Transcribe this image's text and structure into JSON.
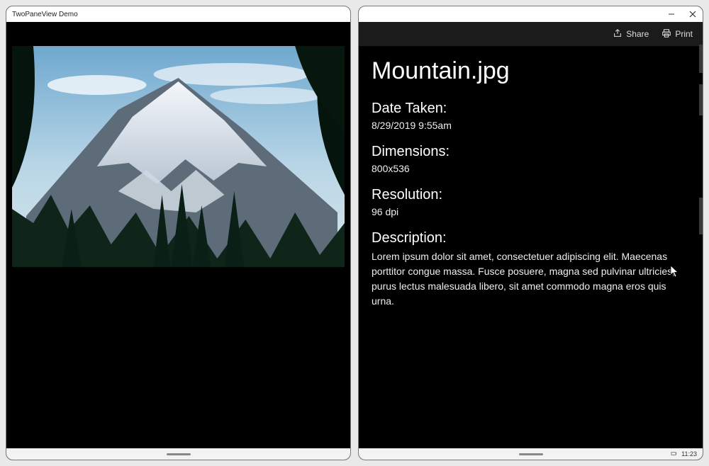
{
  "window": {
    "title": "TwoPaneView Demo",
    "clock": "11:23"
  },
  "commands": {
    "share": "Share",
    "print": "Print"
  },
  "file": {
    "name": "Mountain.jpg"
  },
  "labels": {
    "date_taken": "Date Taken:",
    "dimensions": "Dimensions:",
    "resolution": "Resolution:",
    "description": "Description:"
  },
  "values": {
    "date_taken": "8/29/2019 9:55am",
    "dimensions": "800x536",
    "resolution": "96 dpi",
    "description": "Lorem ipsum dolor sit amet, consectetuer adipiscing elit. Maecenas porttitor congue massa. Fusce posuere, magna sed pulvinar ultricies, purus lectus malesuada libero, sit amet commodo magna eros quis urna."
  }
}
